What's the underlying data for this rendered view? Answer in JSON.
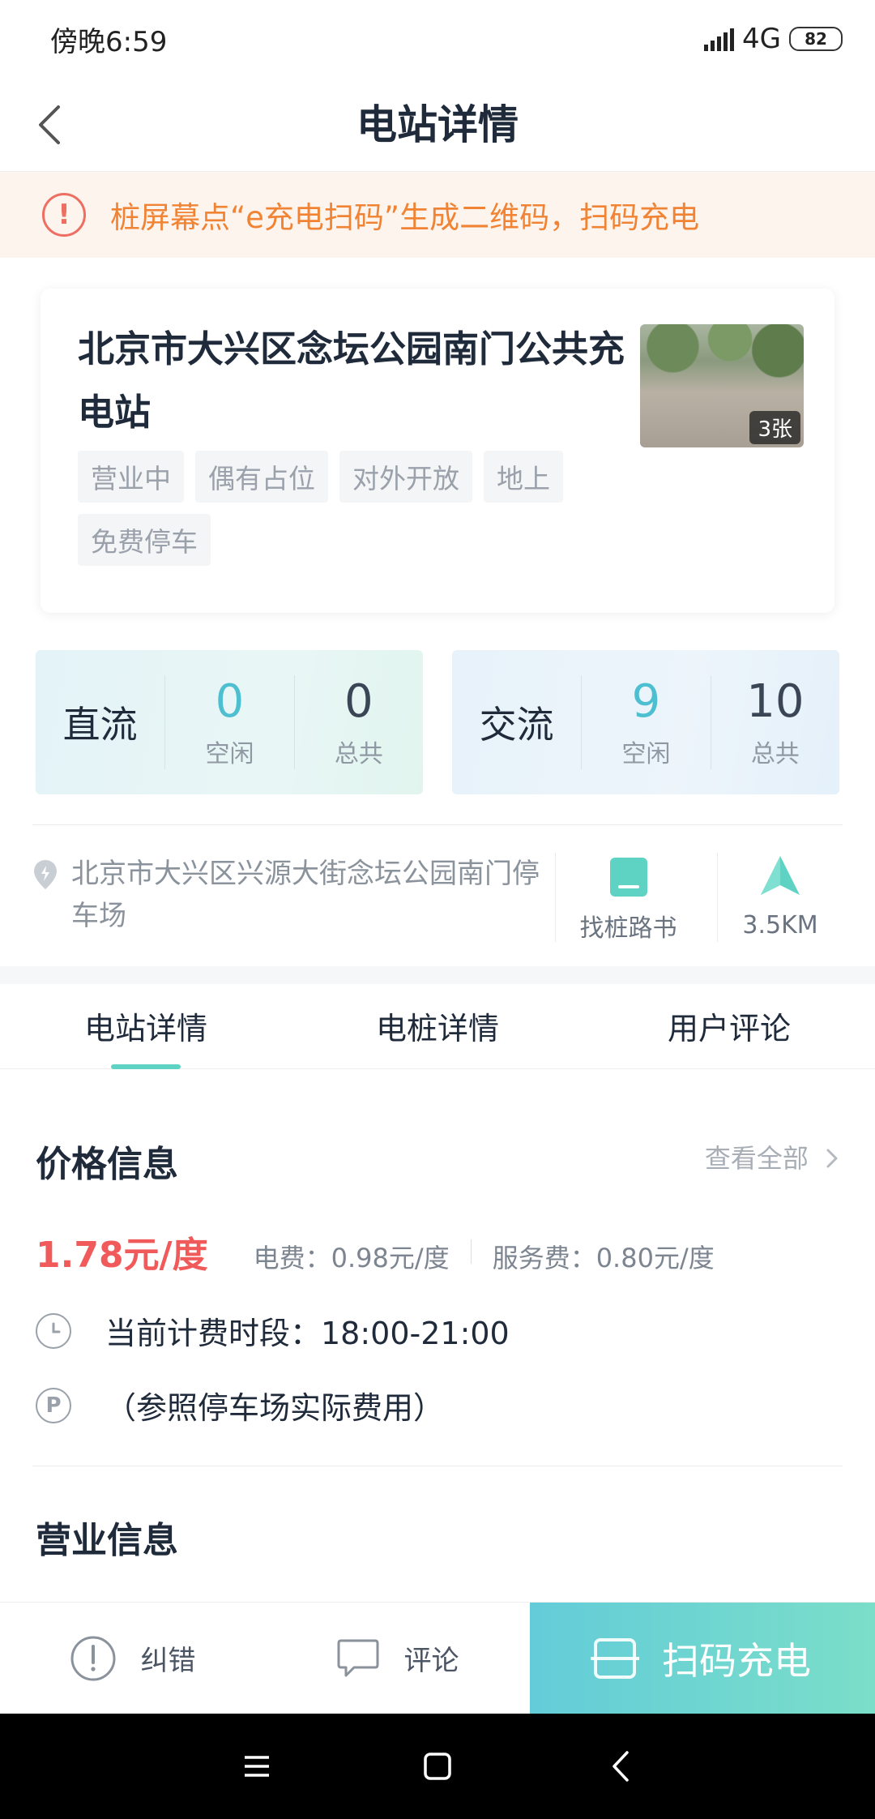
{
  "status_bar": {
    "time": "傍晚6:59",
    "network": "4G",
    "battery": "82"
  },
  "nav": {
    "title": "电站详情"
  },
  "notice": {
    "text": "桩屏幕点“e充电扫码”生成二维码，扫码充电"
  },
  "station": {
    "name": "北京市大兴区念坛公园南门公共充电站",
    "photo_count": "3张",
    "tags": [
      "营业中",
      "偶有占位",
      "对外开放",
      "地上",
      "免费停车"
    ]
  },
  "dc": {
    "label": "直流",
    "free": "0",
    "free_label": "空闲",
    "total": "0",
    "total_label": "总共"
  },
  "ac": {
    "label": "交流",
    "free": "9",
    "free_label": "空闲",
    "total": "10",
    "total_label": "总共"
  },
  "address": {
    "text": "北京市大兴区兴源大街念坛公园南门停车场",
    "route_label": "找桩路书",
    "distance": "3.5KM"
  },
  "tabs": [
    "电站详情",
    "电桩详情",
    "用户评论"
  ],
  "price": {
    "title": "价格信息",
    "view_all": "查看全部",
    "main": "1.78元/度",
    "electricity": "电费：0.98元/度",
    "service": "服务费：0.80元/度",
    "period": "当前计费时段：18:00-21:00",
    "parking": "（参照停车场实际费用）"
  },
  "business": {
    "title": "营业信息"
  },
  "bottom_bar": {
    "report": "纠错",
    "comment": "评论",
    "scan": "扫码充电"
  },
  "colors": {
    "accent": "#5ed3c3",
    "price": "#f05a5a",
    "notice": "#f08434",
    "free_count": "#4dbfd0"
  }
}
